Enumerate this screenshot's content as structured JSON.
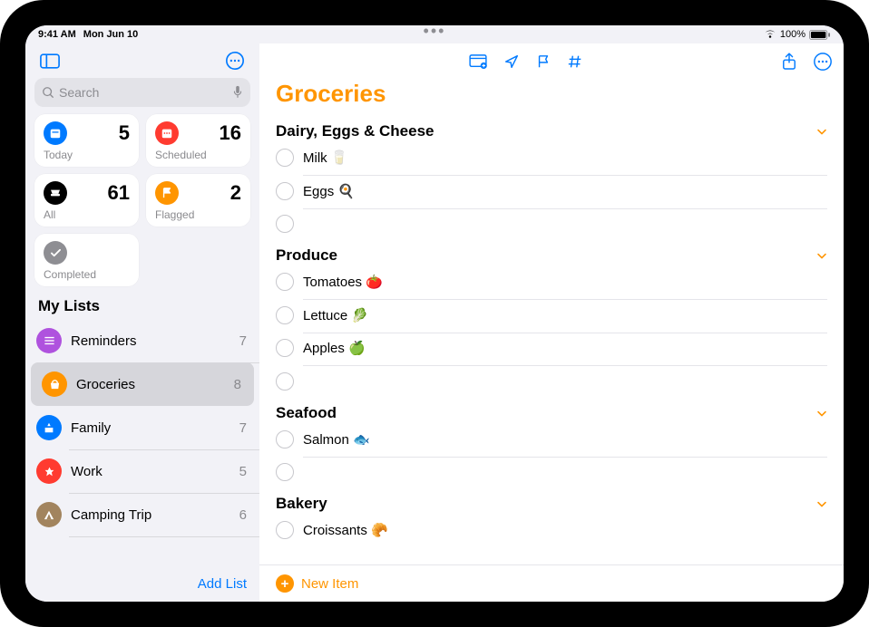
{
  "status": {
    "time": "9:41 AM",
    "date": "Mon Jun 10",
    "battery": "100%"
  },
  "sidebar": {
    "search_placeholder": "Search",
    "smart": [
      {
        "label": "Today",
        "count": 5,
        "color": "#007aff"
      },
      {
        "label": "Scheduled",
        "count": 16,
        "color": "#ff3b30"
      },
      {
        "label": "All",
        "count": 61,
        "color": "#000000"
      },
      {
        "label": "Flagged",
        "count": 2,
        "color": "#ff9500"
      },
      {
        "label": "Completed",
        "count": "",
        "color": "#8e8e93"
      }
    ],
    "lists_title": "My Lists",
    "lists": [
      {
        "name": "Reminders",
        "count": 7,
        "color": "#af52de"
      },
      {
        "name": "Groceries",
        "count": 8,
        "color": "#ff9500",
        "selected": true
      },
      {
        "name": "Family",
        "count": 7,
        "color": "#007aff"
      },
      {
        "name": "Work",
        "count": 5,
        "color": "#ff3b30"
      },
      {
        "name": "Camping Trip",
        "count": 6,
        "color": "#a2845e"
      }
    ],
    "add_list": "Add List"
  },
  "main": {
    "title": "Groceries",
    "new_item": "New Item",
    "sections": [
      {
        "title": "Dairy, Eggs & Cheese",
        "items": [
          "Milk 🥛",
          "Eggs 🍳",
          ""
        ]
      },
      {
        "title": "Produce",
        "items": [
          "Tomatoes 🍅",
          "Lettuce 🥬",
          "Apples 🍏",
          ""
        ]
      },
      {
        "title": "Seafood",
        "items": [
          "Salmon 🐟",
          ""
        ]
      },
      {
        "title": "Bakery",
        "items": [
          "Croissants 🥐"
        ]
      }
    ]
  }
}
